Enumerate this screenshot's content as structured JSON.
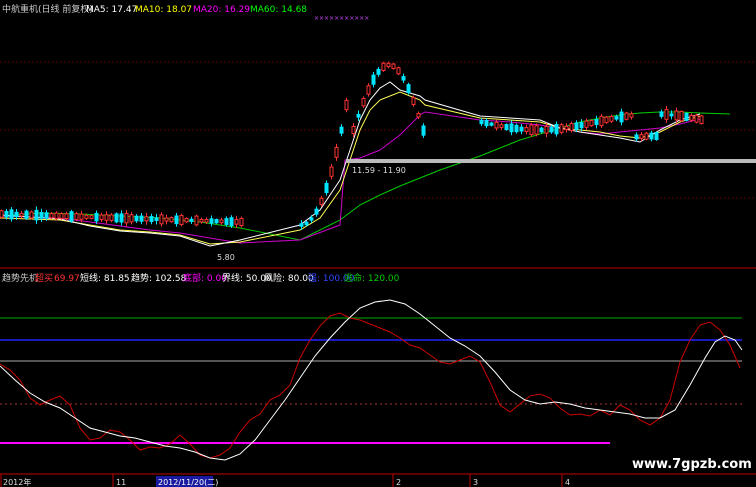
{
  "main_header": {
    "title": "中航重机(日线 前复权)",
    "ma5_label": "MA5: 17.47",
    "ma10_label": "MA10: 18.07",
    "ma20_label": "MA20: 16.29",
    "ma60_label": "MA60: 14.68",
    "marker_text": "×××××××××××"
  },
  "price_annotations": {
    "range_label": "11.59 - 11.90",
    "low_label": "5.80"
  },
  "indicator_header": {
    "name": "趋势先机",
    "overbuy_label": "超买",
    "overbuy_value": "69.97",
    "short_label": "短线: 81.85",
    "trend_label": "趋势: 102.58",
    "bottom_label": "底部: 0.00",
    "boundary_label": "界线: 50.00",
    "risk_label": "风险: 80.00",
    "strong_label": "强: 100.00",
    "escape_label": "逃命: 120.00"
  },
  "time_axis": {
    "labels": [
      "2012年",
      "11",
      "2012/11/20(二)",
      "2",
      "3",
      "4"
    ]
  },
  "watermark": "www.7gpzb.com",
  "colors": {
    "background": "#000000",
    "grid_red": "#8b0000",
    "ma5": "#ffffff",
    "ma10": "#ffff00",
    "ma20": "#ff00ff",
    "ma60": "#00ff00",
    "up": "#ff3333",
    "down": "#00ffff",
    "indicator_white": "#ffffff",
    "indicator_red": "#cc0000",
    "level_green": "#00aa00",
    "level_blue": "#0000ff",
    "level_gray": "#aaaaaa",
    "level_magenta": "#ff00ff"
  }
}
